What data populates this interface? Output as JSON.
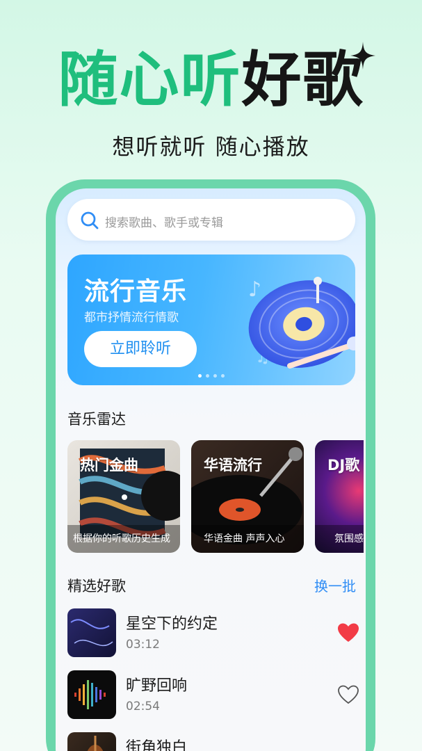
{
  "hero": {
    "title_green": "随心听",
    "title_dark": "好歌",
    "subtitle": "想听就听 随心播放"
  },
  "search": {
    "placeholder": "搜索歌曲、歌手或专辑"
  },
  "banner": {
    "title": "流行音乐",
    "desc": "都市抒情流行情歌",
    "button": "立即聆听",
    "page_count": 4,
    "active_page": 1
  },
  "radar": {
    "title": "音乐雷达",
    "cards": [
      {
        "label": "热门金曲",
        "sub": "根据你的听歌历史生成"
      },
      {
        "label": "华语流行",
        "sub": "华语金曲 声声入心"
      },
      {
        "label": "DJ歌",
        "sub": "氛围感"
      }
    ]
  },
  "picks": {
    "title": "精选好歌",
    "refresh": "换一批",
    "songs": [
      {
        "name": "星空下的约定",
        "duration": "03:12",
        "liked": true
      },
      {
        "name": "旷野回响",
        "duration": "02:54",
        "liked": false
      },
      {
        "name": "街角独白",
        "duration": "",
        "liked": false
      }
    ]
  },
  "colors": {
    "brand_green": "#1fbe7d",
    "accent_blue": "#2f8df5",
    "like_red": "#f23b46"
  }
}
